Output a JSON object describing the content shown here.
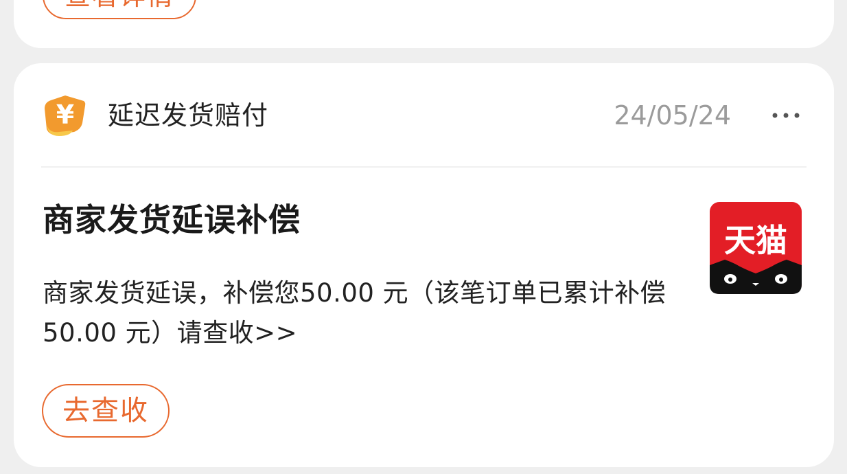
{
  "previous_card": {
    "detail_button_label": "查看详情"
  },
  "notification": {
    "category": "延迟发货赔付",
    "date": "24/05/24",
    "title": "商家发货延误补偿",
    "message": "商家发货延误，补偿您50.00 元（该笔订单已累计补偿50.00 元）请查收>>",
    "action_label": "去查收",
    "logo_text": "天猫",
    "icons": {
      "category_icon": "yen-coin-icon",
      "more_icon": "more-dots-icon",
      "brand_icon": "tmall-logo-icon"
    }
  },
  "colors": {
    "accent": "#e8692f",
    "tmall_red": "#e31e26",
    "icon_orange": "#f29a2e"
  }
}
